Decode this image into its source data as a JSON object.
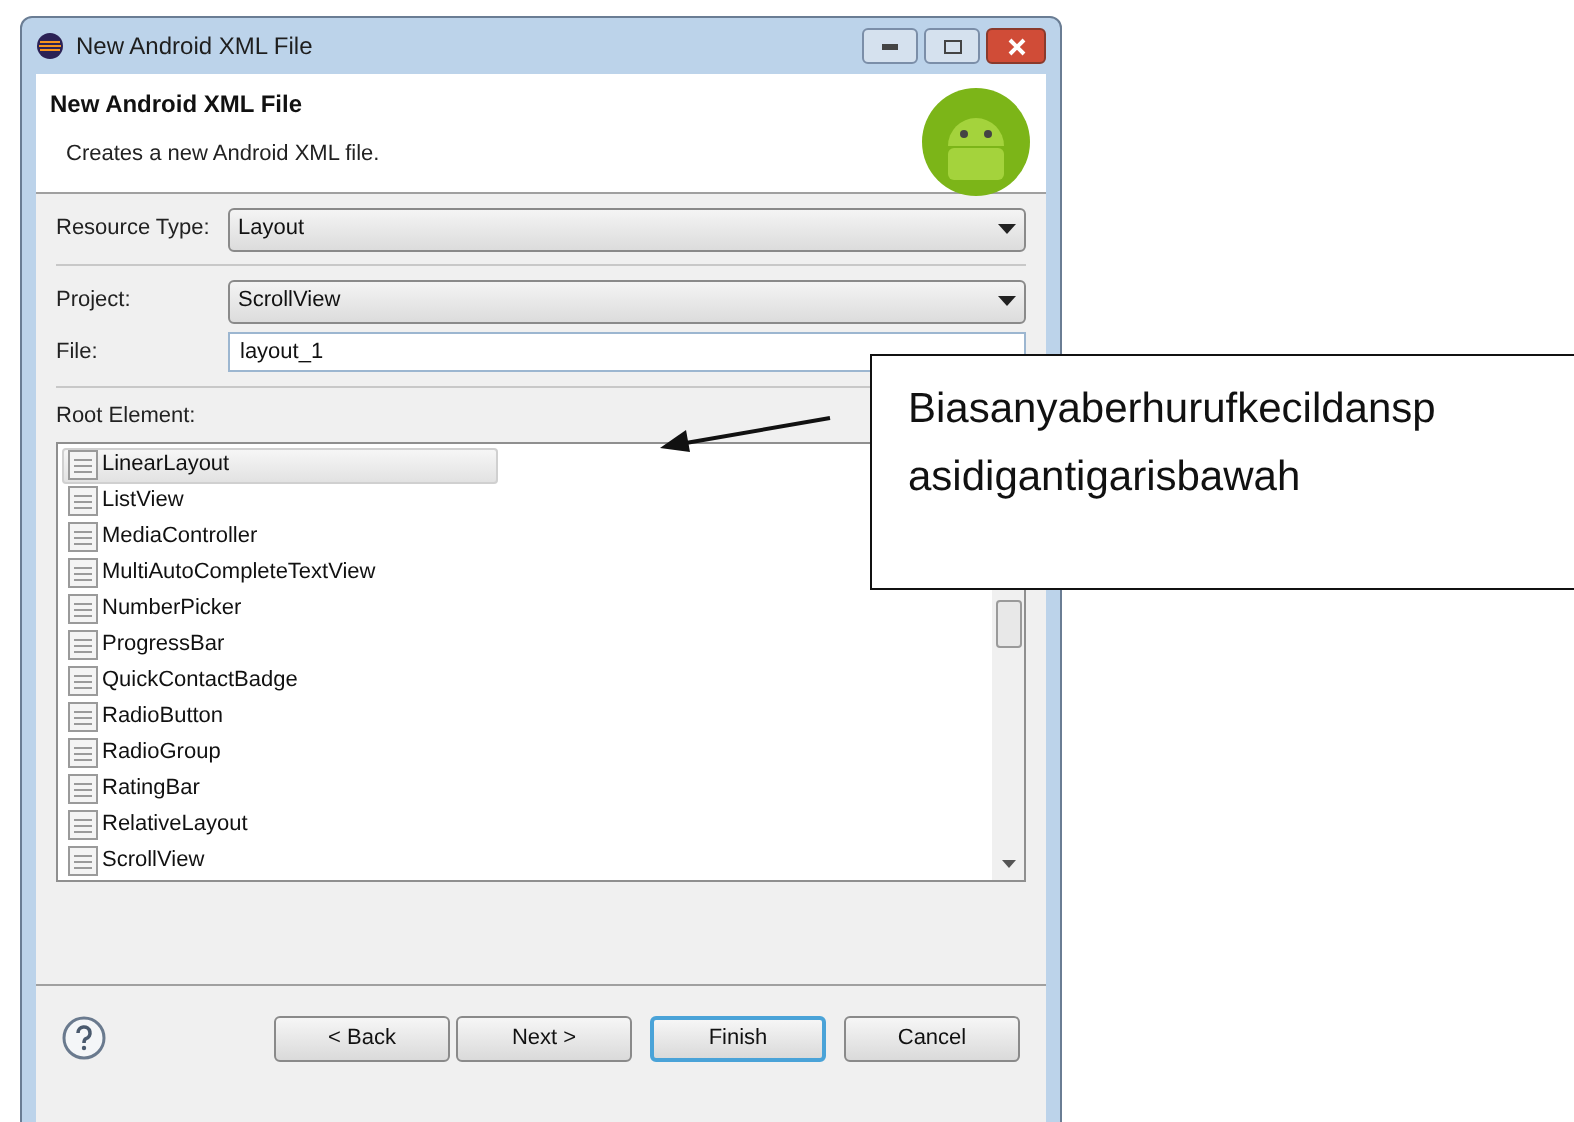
{
  "window": {
    "title": "New Android XML File"
  },
  "header": {
    "title": "New Android XML File",
    "description": "Creates a new Android XML file."
  },
  "form": {
    "resource_type": {
      "label": "Resource Type:",
      "value": "Layout"
    },
    "project": {
      "label": "Project:",
      "value": "ScrollView"
    },
    "file": {
      "label": "File:",
      "value": "layout_1"
    },
    "root_element": {
      "label": "Root Element:"
    }
  },
  "root_elements": [
    {
      "label": "LinearLayout",
      "selected": true
    },
    {
      "label": "ListView",
      "selected": false
    },
    {
      "label": "MediaController",
      "selected": false
    },
    {
      "label": "MultiAutoCompleteTextView",
      "selected": false
    },
    {
      "label": "NumberPicker",
      "selected": false
    },
    {
      "label": "ProgressBar",
      "selected": false
    },
    {
      "label": "QuickContactBadge",
      "selected": false
    },
    {
      "label": "RadioButton",
      "selected": false
    },
    {
      "label": "RadioGroup",
      "selected": false
    },
    {
      "label": "RatingBar",
      "selected": false
    },
    {
      "label": "RelativeLayout",
      "selected": false
    },
    {
      "label": "ScrollView",
      "selected": false
    }
  ],
  "buttons": [
    {
      "label": "< Back",
      "default": false
    },
    {
      "label": "Next >",
      "default": false
    },
    {
      "label": "Finish",
      "default": true
    },
    {
      "label": "Cancel",
      "default": false
    }
  ],
  "callout": {
    "lines": [
      "Biasanyaberhurufkecildansp",
      "asidigantigarisbawah"
    ]
  }
}
